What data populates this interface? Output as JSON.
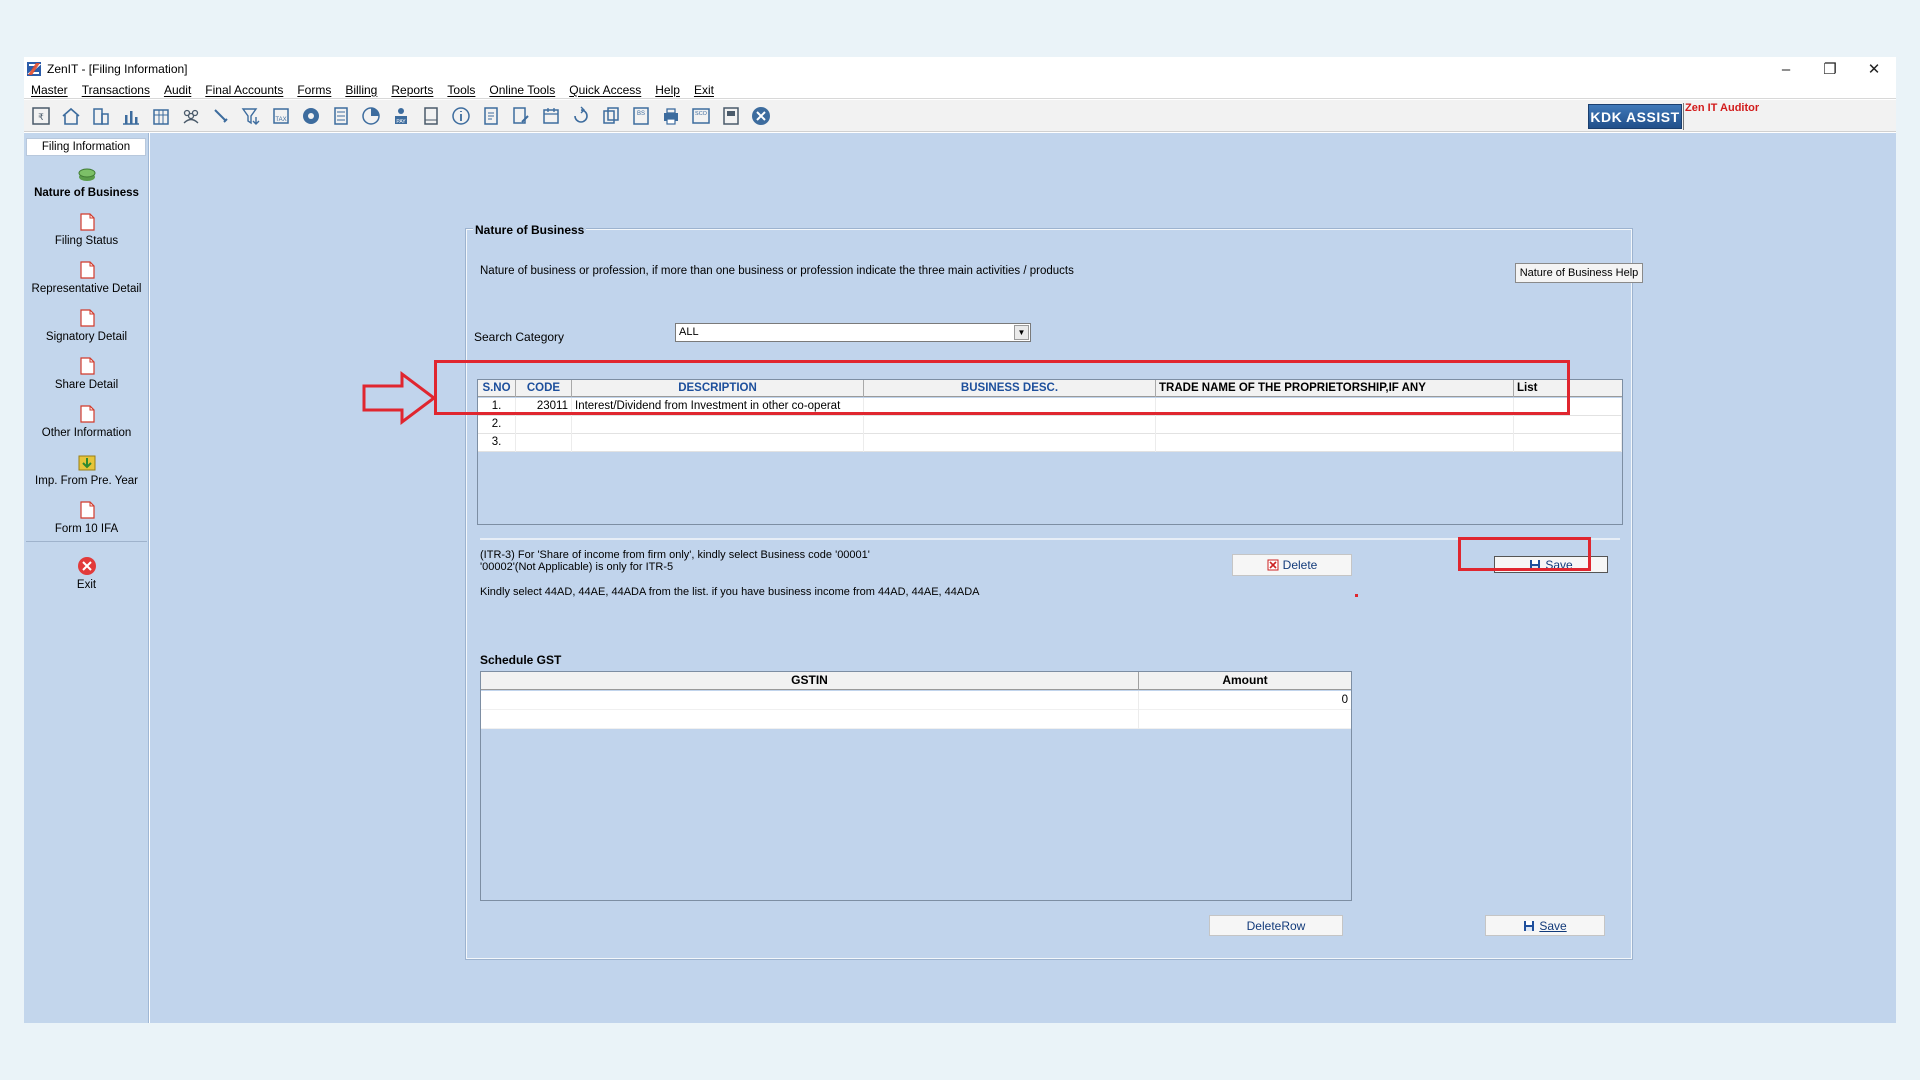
{
  "window": {
    "title": "ZenIT - [Filing Information]",
    "controls": {
      "minimize": "–",
      "restore": "❐",
      "close": "✕"
    }
  },
  "menu": [
    "Master",
    "Transactions",
    "Audit",
    "Final Accounts",
    "Forms",
    "Billing",
    "Reports",
    "Tools",
    "Online Tools",
    "Quick Access",
    "Help",
    "Exit"
  ],
  "toolbar": {
    "icons": [
      "itr-icon",
      "home-icon",
      "building-icon",
      "bar-chart-icon",
      "calendar-grid-icon",
      "users-icon",
      "wrench-icon",
      "filter-icon",
      "tax-icon",
      "disc-icon",
      "calculator-icon",
      "pie-chart-icon",
      "pay-icon",
      "book-icon",
      "info-icon",
      "document-icon",
      "edit-document-icon",
      "calendar-icon",
      "refresh-icon",
      "copy-icon",
      "bs-icon",
      "printer-icon",
      "sco-icon",
      "report-icon",
      "close-circle-icon"
    ],
    "kdk_assist": "KDK ASSIST",
    "zen_label": "Zen IT Auditor"
  },
  "sidebar": {
    "heading": "Filing Information",
    "items": [
      {
        "label": "Nature of Business",
        "active": true
      },
      {
        "label": "Filing Status"
      },
      {
        "label": "Representative Detail"
      },
      {
        "label": "Signatory Detail"
      },
      {
        "label": "Share Detail"
      },
      {
        "label": "Other Information"
      },
      {
        "label": "Imp. From Pre. Year"
      },
      {
        "label": "Form 10 IFA"
      }
    ],
    "exit": "Exit"
  },
  "nob": {
    "panel_title": "Nature of Business",
    "description": "Nature of business or profession, if more than one business or profession indicate the three main activities / products",
    "help_button": "Nature of Business Help",
    "search_label": "Search Category",
    "search_value": "ALL",
    "columns": [
      "S.NO",
      "CODE",
      "DESCRIPTION",
      "BUSINESS DESC.",
      "TRADE NAME OF THE PROPRIETORSHIP,IF ANY",
      "List"
    ],
    "rows": [
      {
        "sno": "1.",
        "code": "23011",
        "description": "Interest/Dividend from Investment in other co-operat",
        "business_desc": "",
        "trade_name": "",
        "list": ""
      },
      {
        "sno": "2.",
        "code": "",
        "description": "",
        "business_desc": "",
        "trade_name": "",
        "list": ""
      },
      {
        "sno": "3.",
        "code": "",
        "description": "",
        "business_desc": "",
        "trade_name": "",
        "list": ""
      }
    ],
    "note_line1": "(ITR-3) For 'Share of income from firm only', kindly select Business code '00001'",
    "note_line2": "'00002'(Not Applicable) is only for ITR-5",
    "note_line3": "Kindly select 44AD, 44AE, 44ADA from the list. if you have business income from 44AD, 44AE, 44ADA",
    "delete_button": "Delete",
    "save_button": "Save"
  },
  "gst": {
    "title": "Schedule GST",
    "columns": [
      "GSTIN",
      "Amount"
    ],
    "rows": [
      {
        "gstin": "",
        "amount": "0"
      }
    ],
    "deleterow_button": "DeleteRow",
    "save_button": "Save"
  },
  "colors": {
    "main_bg": "#c1d4ec",
    "sidebar_bg": "#c3d6ec",
    "annotation_red": "#e0262f",
    "header_blue_text": "#1d4f9c"
  }
}
